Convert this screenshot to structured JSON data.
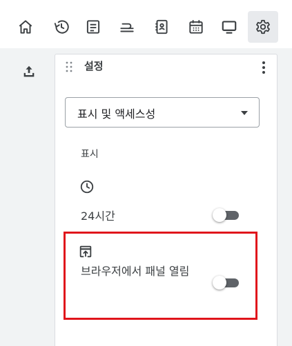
{
  "toolbar": {
    "buttons": [
      {
        "name": "home",
        "icon": "home-icon"
      },
      {
        "name": "history",
        "icon": "history-icon"
      },
      {
        "name": "document",
        "icon": "document-icon"
      },
      {
        "name": "stack",
        "icon": "stack-icon"
      },
      {
        "name": "contacts",
        "icon": "contacts-book-icon"
      },
      {
        "name": "calendar",
        "icon": "calendar-icon"
      },
      {
        "name": "screen",
        "icon": "monitor-icon"
      },
      {
        "name": "settings",
        "icon": "gear-icon",
        "active": true
      }
    ]
  },
  "rail": {
    "upload_icon": "upload-icon"
  },
  "panel": {
    "title": "설정",
    "dropdown": {
      "selected": "표시 및 액세스성"
    },
    "section_label": "표시",
    "settings": [
      {
        "icon": "clock-icon",
        "label": "24시간",
        "enabled": false
      },
      {
        "icon": "open-in-browser-icon",
        "label": "브라우저에서 패널 열림",
        "enabled": false
      }
    ]
  },
  "colors": {
    "highlight": "#e0141b",
    "rail_bg": "#f1f3f4",
    "active_tab_bg": "#e8eaed",
    "toggle_track": "#5f6368"
  }
}
